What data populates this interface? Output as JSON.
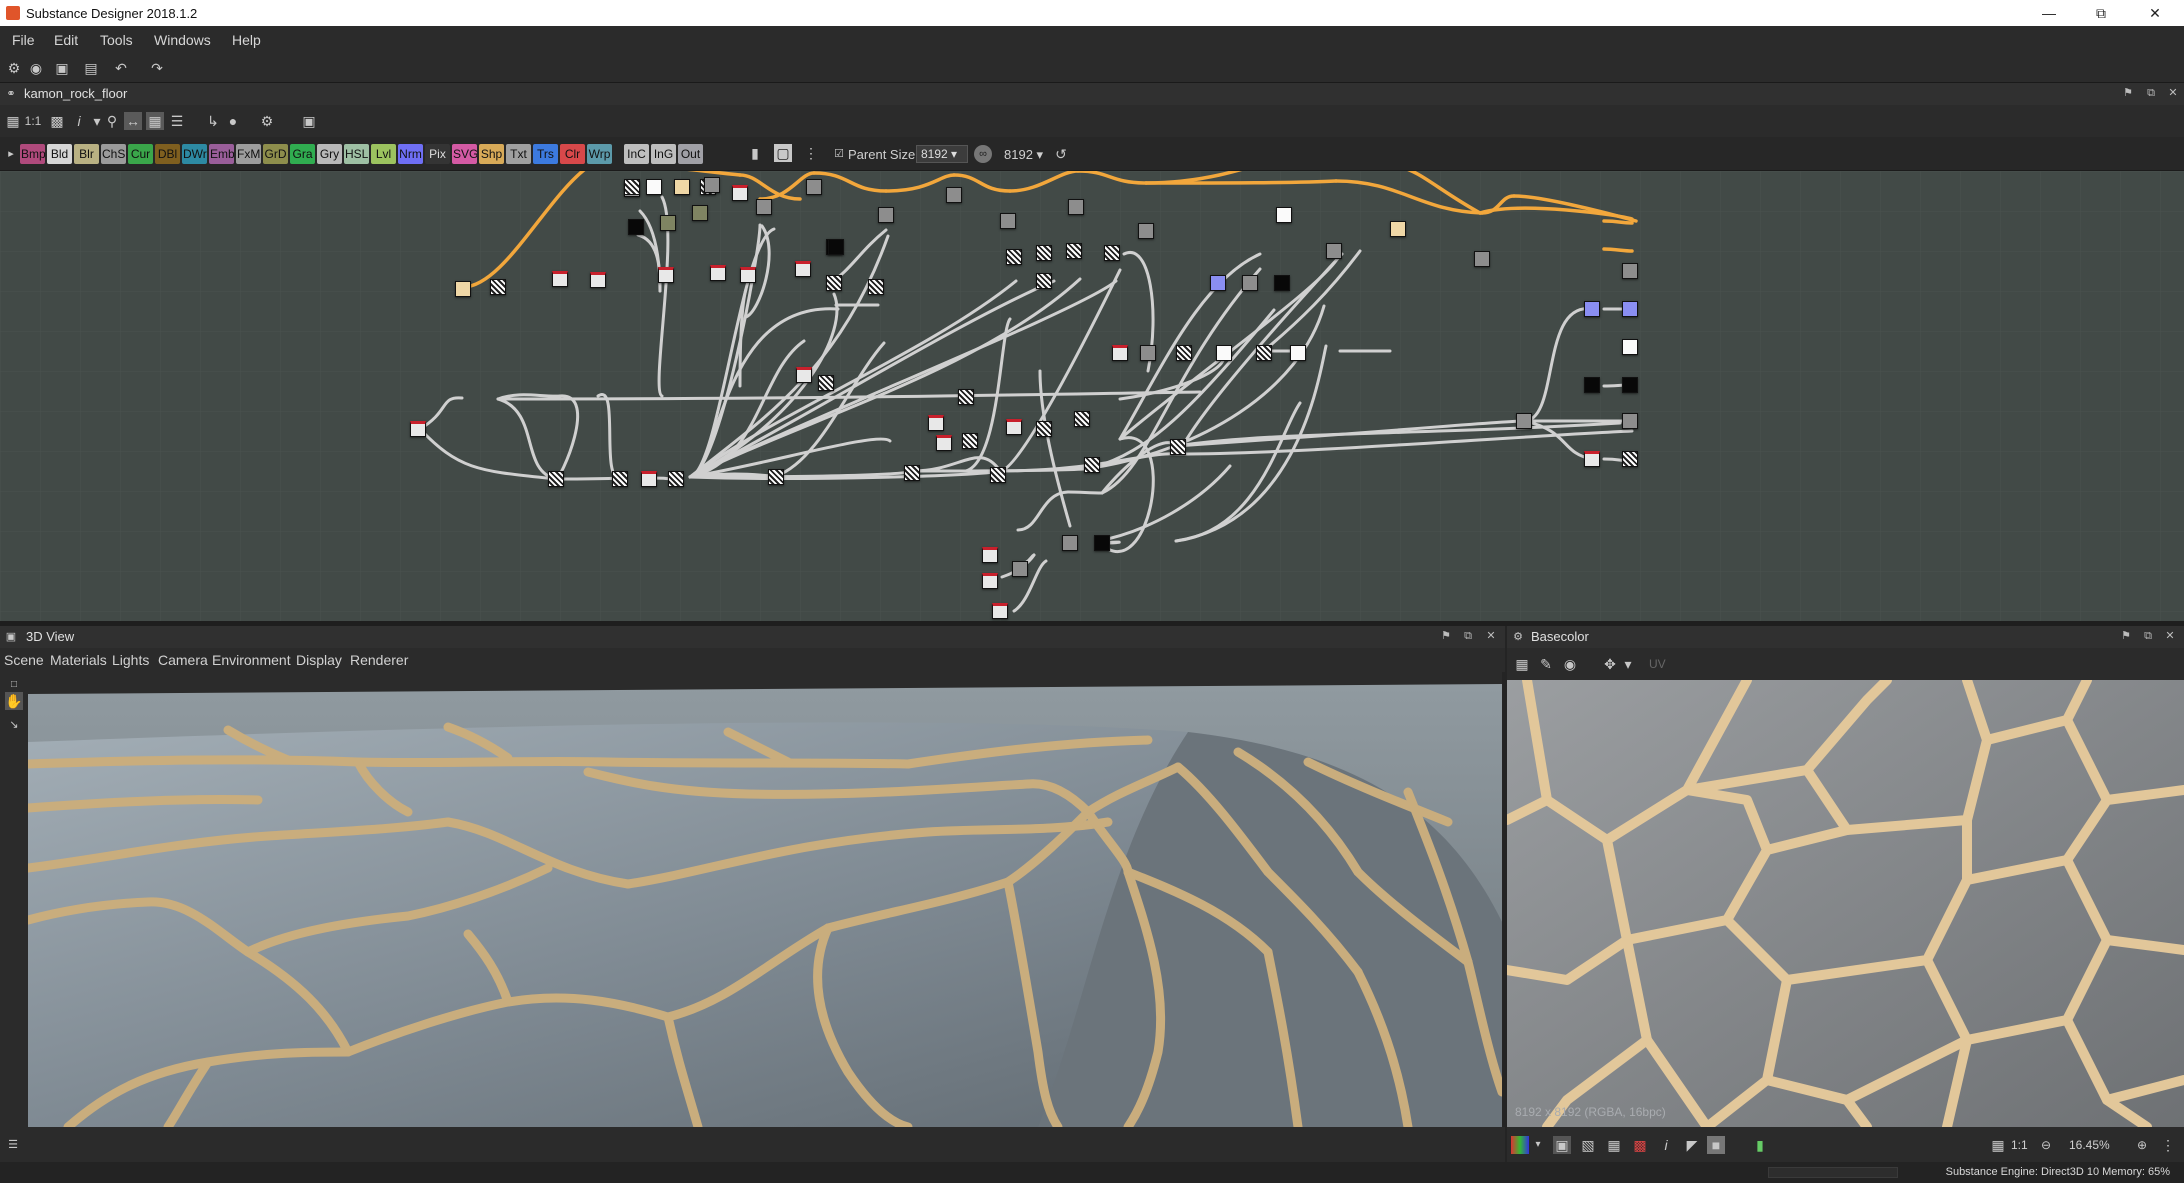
{
  "window": {
    "title": "Substance Designer 2018.1.2"
  },
  "menu": [
    "File",
    "Edit",
    "Tools",
    "Windows",
    "Help"
  ],
  "graph": {
    "tab_title": "kamon_rock_floor",
    "parent_size_label": "Parent Size:",
    "parent_size_value": "8192",
    "size_value": "8192"
  },
  "filters": [
    {
      "label": "Bmp",
      "color": "#b04a7c"
    },
    {
      "label": "Bld",
      "color": "#d6d6d6"
    },
    {
      "label": "Blr",
      "color": "#b9b183"
    },
    {
      "label": "ChS",
      "color": "#9b9b9b"
    },
    {
      "label": "Cur",
      "color": "#3aa64a"
    },
    {
      "label": "DBl",
      "color": "#7f5f1f"
    },
    {
      "label": "DWr",
      "color": "#2d8aa3"
    },
    {
      "label": "Emb",
      "color": "#9a5e9a"
    },
    {
      "label": "FxM",
      "color": "#9d9d9d"
    },
    {
      "label": "GrD",
      "color": "#8e8e4c"
    },
    {
      "label": "Gra",
      "color": "#30ad50"
    },
    {
      "label": "Gry",
      "color": "#b9b9b9"
    },
    {
      "label": "HSL",
      "color": "#9ec0a4"
    },
    {
      "label": "Lvl",
      "color": "#9cc35f"
    },
    {
      "label": "Nrm",
      "color": "#6f6ff5"
    },
    {
      "label": "Pix",
      "color": "#343434"
    },
    {
      "label": "SVG",
      "color": "#d45aa4"
    },
    {
      "label": "Shp",
      "color": "#d8aa58"
    },
    {
      "label": "Txt",
      "color": "#a0a0a0"
    },
    {
      "label": "Trs",
      "color": "#3c7adf"
    },
    {
      "label": "Clr",
      "color": "#d8484a"
    },
    {
      "label": "Wrp",
      "color": "#5c9aaa"
    },
    {
      "label": "InC",
      "color": "#bebebe"
    },
    {
      "label": "InG",
      "color": "#bebebe"
    },
    {
      "label": "Out",
      "color": "#a0a0a6"
    }
  ],
  "viewport3d": {
    "title": "3D View",
    "menu": [
      "Scene",
      "Materials",
      "Lights",
      "Camera",
      "Environment",
      "Display",
      "Renderer"
    ]
  },
  "basecolor": {
    "title": "Basecolor",
    "uv_label": "UV",
    "info": "8192 x 8192 (RGBA, 16bpc)",
    "zoom_ratio": "1:1",
    "zoom": "16.45%"
  },
  "status": {
    "text": "Substance Engine: Direct3D 10  Memory: 65%"
  },
  "colors": {
    "accent_edge": "#f0a43a",
    "canvas": "#424a47",
    "sand": "#d9c49a",
    "stone": "#9aa1a6"
  }
}
